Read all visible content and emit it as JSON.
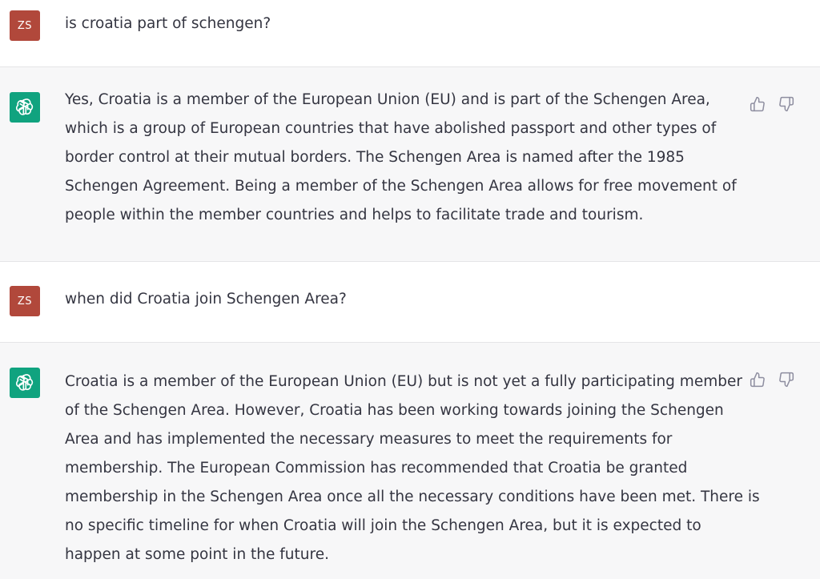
{
  "conversation": {
    "turns": [
      {
        "role": "user",
        "avatar": "ZS",
        "lines": [
          "is croatia part of schengen?"
        ]
      },
      {
        "role": "assistant",
        "avatar_icon": "openai-logo-icon",
        "lines": [
          "Yes, Croatia is a member of the European Union (EU) and is part of the Schengen Area,",
          "which is a group of European countries that have abolished passport and other types of",
          "border control at their mutual borders. The Schengen Area is named after the 1985",
          "Schengen Agreement. Being a member of the Schengen Area allows for free movement of",
          "people within the member countries and helps to facilitate trade and tourism."
        ]
      },
      {
        "role": "user",
        "avatar": "ZS",
        "lines": [
          "when did Croatia join Schengen Area?"
        ]
      },
      {
        "role": "assistant",
        "avatar_icon": "openai-logo-icon",
        "lines": [
          "Croatia is a member of the European Union (EU) but is not yet a fully participating member",
          "of the Schengen Area. However, Croatia has been working towards joining the Schengen",
          "Area and has implemented the necessary measures to meet the requirements for",
          "membership. The European Commission has recommended that Croatia be granted",
          "membership in the Schengen Area once all the necessary conditions have been met. There is",
          "no specific timeline for when Croatia will join the Schengen Area, but it is expected to",
          "happen at some point in the future."
        ]
      }
    ]
  },
  "colors": {
    "user_avatar_bg": "#b1483b",
    "assistant_avatar_bg": "#10a37f",
    "assistant_row_bg": "#f7f7f8",
    "text": "#343541",
    "icon": "#8e8ea0"
  },
  "icons": {
    "thumbs_up": "thumbs-up-icon",
    "thumbs_down": "thumbs-down-icon"
  }
}
